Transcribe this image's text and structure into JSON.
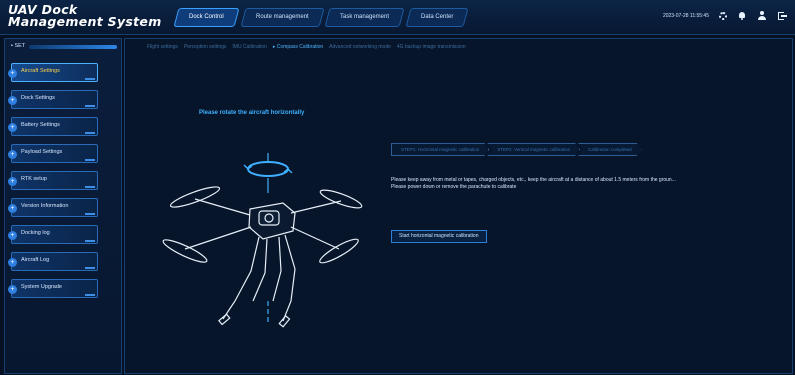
{
  "app": {
    "title": "UAV Dock Management System"
  },
  "header": {
    "tabs": [
      {
        "label": "Dock Control",
        "active": true
      },
      {
        "label": "Route management",
        "active": false
      },
      {
        "label": "Task management",
        "active": false
      },
      {
        "label": "Data Center",
        "active": false
      }
    ],
    "datetime": "2023-07-28 11:55:45",
    "icons": [
      "gear-icon",
      "bell-icon",
      "user-icon",
      "logout-icon"
    ]
  },
  "sidebar": {
    "title": "SET",
    "items": [
      {
        "label": "Aircraft Settings",
        "active": true
      },
      {
        "label": "Dock Settings",
        "active": false
      },
      {
        "label": "Battery Settings",
        "active": false
      },
      {
        "label": "Payload Settings",
        "active": false
      },
      {
        "label": "RTK setup",
        "active": false
      },
      {
        "label": "Version Information",
        "active": false
      },
      {
        "label": "Docking log",
        "active": false
      },
      {
        "label": "Aircraft Log",
        "active": false
      },
      {
        "label": "System Upgrade",
        "active": false
      }
    ]
  },
  "main": {
    "subtabs": [
      {
        "label": "Flight settings",
        "active": false
      },
      {
        "label": "Perception settings",
        "active": false
      },
      {
        "label": "IMU Calibration",
        "active": false
      },
      {
        "label": "▸ Compass Calibration",
        "active": true
      },
      {
        "label": "Advanced networking mode",
        "active": false
      },
      {
        "label": "4G backup image transmission",
        "active": false
      }
    ],
    "prompt": "Please rotate the aircraft horizontally",
    "steps": [
      "STEP1: Horizontal magnetic calibration",
      "STEP2: Vertical magnetic calibration",
      "Calibration completed"
    ],
    "notes": [
      "Please keep away from metal or tapes, charged objects, etc., keep the aircraft at a distance of about 1.5 meters from the groun...",
      "Please power down or remove the parachute to calibrate"
    ],
    "start_button": "Start horizontal magnetic calibration"
  },
  "colors": {
    "background": "#061224",
    "accent": "#3fb0ff",
    "active_menu_text": "#ffd44a",
    "border": "#163e70"
  }
}
